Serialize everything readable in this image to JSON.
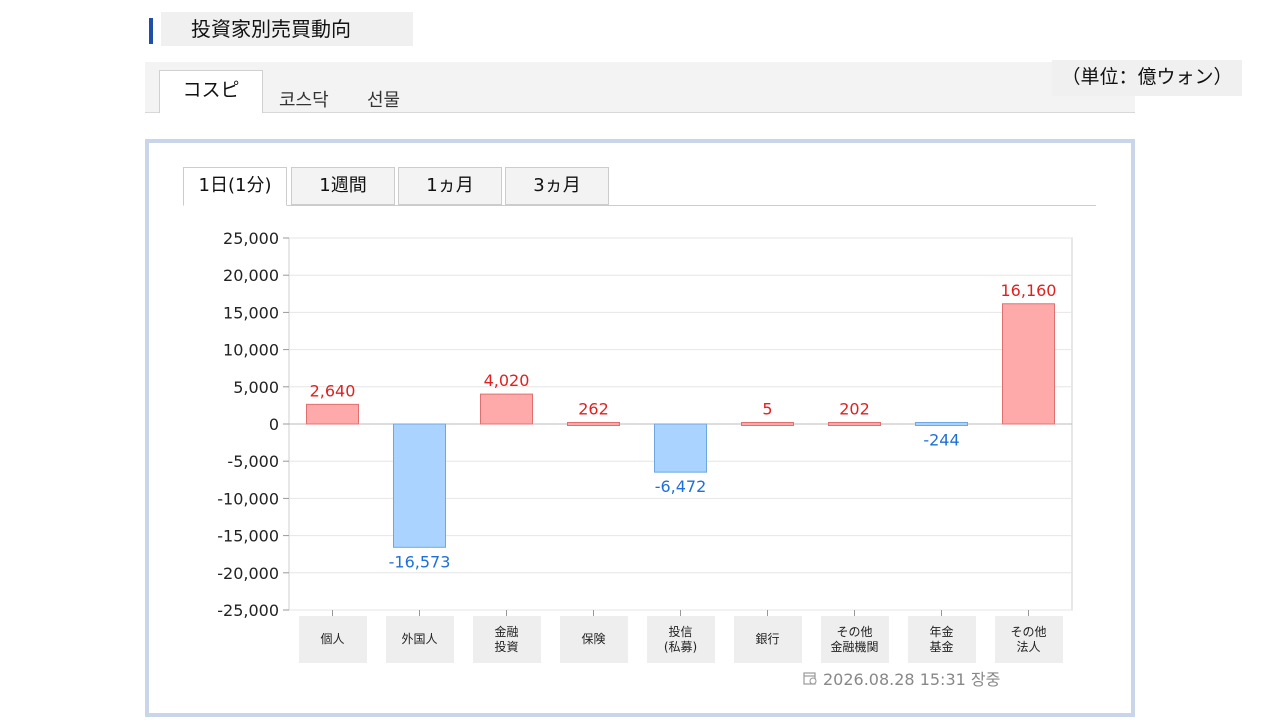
{
  "page": {
    "title": "投資家別売買動向"
  },
  "market_tabs": [
    "コスピ",
    "코스닥",
    "선물"
  ],
  "unit": "（単位：億ウォン）",
  "period_tabs": [
    "1日(1分)",
    "1週間",
    "1ヵ月",
    "3ヵ月"
  ],
  "timestamp": "2026.08.28 15:31 장중",
  "colors": {
    "positive_fill": "#ffaaaa",
    "negative_fill": "#aad4ff",
    "positive_text": "#e02020",
    "negative_text": "#1e6fd9"
  },
  "chart_data": {
    "type": "bar",
    "categories": [
      "個人",
      "外国人",
      "金融\n投資",
      "保険",
      "投信\n(私募)",
      "銀行",
      "その他\n金融機関",
      "年金\n基金",
      "その他\n法人"
    ],
    "values": [
      2640,
      -16573,
      4020,
      262,
      -6472,
      5,
      202,
      -244,
      16160
    ],
    "value_labels": [
      "2,640",
      "-16,573",
      "4,020",
      "262",
      "-6,472",
      "5",
      "202",
      "-244",
      "16,160"
    ],
    "ylim": [
      -25000,
      25000
    ],
    "yticks": [
      25000,
      20000,
      15000,
      10000,
      5000,
      0,
      -5000,
      -10000,
      -15000,
      -20000,
      -25000
    ],
    "ytick_labels": [
      "25,000",
      "20,000",
      "15,000",
      "10,000",
      "5,000",
      "0",
      "-5,000",
      "-10,000",
      "-15,000",
      "-20,000",
      "-25,000"
    ],
    "grid": true
  }
}
